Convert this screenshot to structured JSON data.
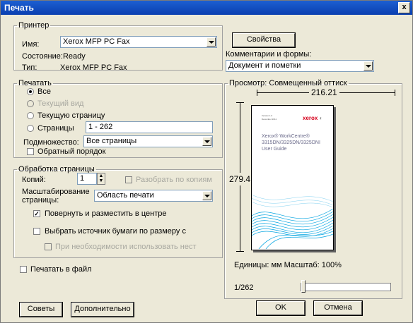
{
  "window": {
    "title": "Печать",
    "close": "x"
  },
  "printer": {
    "legend": "Принтер",
    "name_label": "Имя:",
    "name_value": "Xerox MFP PC Fax",
    "properties_button": "Свойства",
    "comments_label": "Комментарии и формы:",
    "comments_value": "Документ и пометки",
    "status_label": "Состояние:",
    "status_value": "Ready",
    "type_label": "Тип:",
    "type_value": "Xerox MFP PC Fax"
  },
  "print_range": {
    "legend": "Печатать",
    "all": "Все",
    "current_view": "Текущий вид",
    "current_page": "Текущую страницу",
    "pages": "Страницы",
    "pages_value": "1 - 262",
    "subset_label": "Подмножество:",
    "subset_value": "Все страницы",
    "reverse": "Обратный порядок"
  },
  "page_handling": {
    "legend": "Обработка страницы",
    "copies_label": "Копий:",
    "copies_value": "1",
    "collate": "Разобрать по копиям",
    "scaling_label_1": "Масштабирование",
    "scaling_label_2": "страницы:",
    "scaling_value": "Область печати",
    "rotate_center": "Повернуть и разместить в центре",
    "choose_source": "Выбрать источник бумаги по размеру с",
    "custom_size": "При необходимости использовать нест"
  },
  "print_to_file": "Печатать в файл",
  "preview": {
    "legend": "Просмотр: Совмещенный оттиск",
    "width": "216.21",
    "height": "279.4",
    "doc_small_1": "Version 1.0",
    "doc_small_2": "December 2011",
    "doc_logo": "xerox",
    "doc_title_1": "Xerox® WorkCentre®",
    "doc_title_2": "3315DN/3325DN/3325DNI",
    "doc_title_3": "User Guide",
    "units": "Единицы: мм Масштаб: 100%",
    "page_indicator": "1/262",
    "slider_position": 0
  },
  "buttons": {
    "tips": "Советы",
    "advanced": "Дополнительно",
    "ok": "OK",
    "cancel": "Отмена"
  },
  "colors": {
    "titlebar": "#0a3fb0",
    "dialog": "#ece9d8",
    "xerox_red": "#d6001c",
    "wave_blue": "#00a3e0"
  }
}
